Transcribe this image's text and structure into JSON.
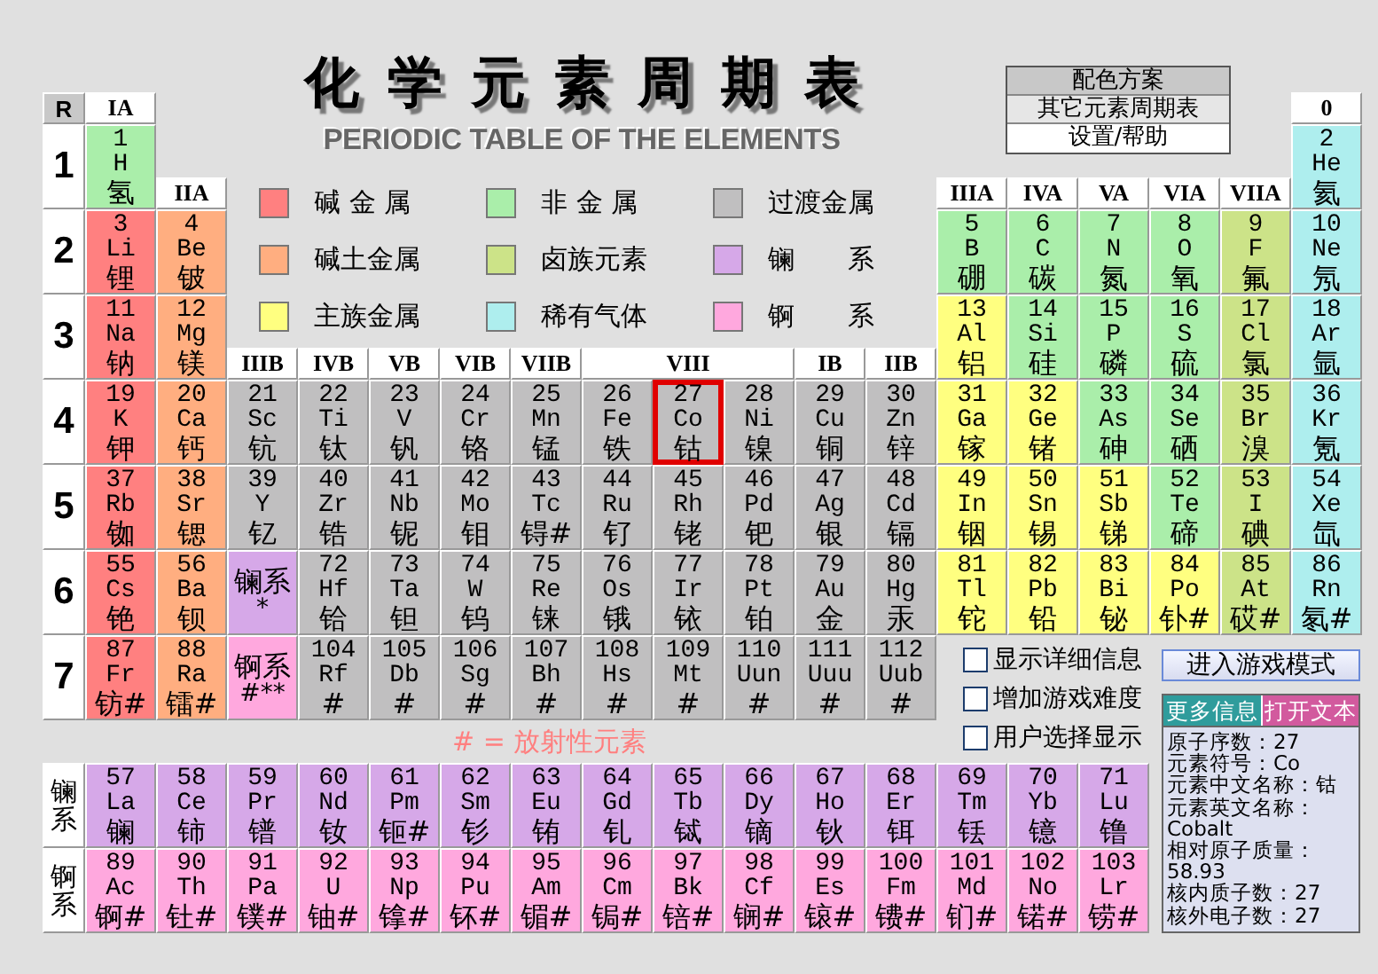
{
  "title": "化学元素周期表",
  "subtitle": "PERIODIC TABLE OF THE ELEMENTS",
  "menu": [
    {
      "label": "配色方案",
      "color": "#c8c8c8"
    },
    {
      "label": "其它元素周期表",
      "color": "#e6e6e6"
    },
    {
      "label": "设置/帮助",
      "color": "#ffffff"
    }
  ],
  "legend": [
    {
      "label": "碱 金 属",
      "kind": "alkali",
      "color": "#ff8080"
    },
    {
      "label": "非 金 属",
      "kind": "nonmetal",
      "color": "#aaeeaa"
    },
    {
      "label": "过渡金属",
      "kind": "transition",
      "color": "#c0bfc0"
    },
    {
      "label": "碱土金属",
      "kind": "alkaline",
      "color": "#ffae80"
    },
    {
      "label": "卤族元素",
      "kind": "halogen",
      "color": "#cce388"
    },
    {
      "label": "镧　　系",
      "kind": "lanthanide",
      "color": "#d6a8e8"
    },
    {
      "label": "主族金属",
      "kind": "metal",
      "color": "#ffff80"
    },
    {
      "label": "稀有气体",
      "kind": "noble",
      "color": "#aeeeee"
    },
    {
      "label": "锕　　系",
      "kind": "actinide",
      "color": "#ffa8de"
    }
  ],
  "corner_label": "R",
  "group_headers": [
    "IA",
    "IIA",
    "IIIB",
    "IVB",
    "VB",
    "VIB",
    "VIIB",
    "VIII",
    "IB",
    "IIB",
    "IIIA",
    "IVA",
    "VA",
    "VIA",
    "VIIA",
    "0"
  ],
  "period_labels": [
    "1",
    "2",
    "3",
    "4",
    "5",
    "6",
    "7"
  ],
  "series_markers": [
    {
      "label": "镧系",
      "mark": "*",
      "kind": "lanthanide"
    },
    {
      "label": "锕系",
      "mark": "#**",
      "kind": "actinide"
    }
  ],
  "series_labels": [
    "镧系",
    "锕系"
  ],
  "elements": [
    {
      "number": "1",
      "symbol": "H",
      "name": "氢",
      "kind": "nonmetal",
      "selected": false
    },
    {
      "number": "2",
      "symbol": "He",
      "name": "氦",
      "kind": "noble",
      "selected": false
    },
    {
      "number": "3",
      "symbol": "Li",
      "name": "锂",
      "kind": "alkali",
      "selected": false
    },
    {
      "number": "4",
      "symbol": "Be",
      "name": "铍",
      "kind": "alkaline",
      "selected": false
    },
    {
      "number": "5",
      "symbol": "B",
      "name": "硼",
      "kind": "nonmetal",
      "selected": false
    },
    {
      "number": "6",
      "symbol": "C",
      "name": "碳",
      "kind": "nonmetal",
      "selected": false
    },
    {
      "number": "7",
      "symbol": "N",
      "name": "氮",
      "kind": "nonmetal",
      "selected": false
    },
    {
      "number": "8",
      "symbol": "O",
      "name": "氧",
      "kind": "nonmetal",
      "selected": false
    },
    {
      "number": "9",
      "symbol": "F",
      "name": "氟",
      "kind": "halogen",
      "selected": false
    },
    {
      "number": "10",
      "symbol": "Ne",
      "name": "氖",
      "kind": "noble",
      "selected": false
    },
    {
      "number": "11",
      "symbol": "Na",
      "name": "钠",
      "kind": "alkali",
      "selected": false
    },
    {
      "number": "12",
      "symbol": "Mg",
      "name": "镁",
      "kind": "alkaline",
      "selected": false
    },
    {
      "number": "13",
      "symbol": "Al",
      "name": "铝",
      "kind": "metal",
      "selected": false
    },
    {
      "number": "14",
      "symbol": "Si",
      "name": "硅",
      "kind": "nonmetal",
      "selected": false
    },
    {
      "number": "15",
      "symbol": "P",
      "name": "磷",
      "kind": "nonmetal",
      "selected": false
    },
    {
      "number": "16",
      "symbol": "S",
      "name": "硫",
      "kind": "nonmetal",
      "selected": false
    },
    {
      "number": "17",
      "symbol": "Cl",
      "name": "氯",
      "kind": "halogen",
      "selected": false
    },
    {
      "number": "18",
      "symbol": "Ar",
      "name": "氩",
      "kind": "noble",
      "selected": false
    },
    {
      "number": "19",
      "symbol": "K",
      "name": "钾",
      "kind": "alkali",
      "selected": false
    },
    {
      "number": "20",
      "symbol": "Ca",
      "name": "钙",
      "kind": "alkaline",
      "selected": false
    },
    {
      "number": "21",
      "symbol": "Sc",
      "name": "钪",
      "kind": "transition",
      "selected": false
    },
    {
      "number": "22",
      "symbol": "Ti",
      "name": "钛",
      "kind": "transition",
      "selected": false
    },
    {
      "number": "23",
      "symbol": "V",
      "name": "钒",
      "kind": "transition",
      "selected": false
    },
    {
      "number": "24",
      "symbol": "Cr",
      "name": "铬",
      "kind": "transition",
      "selected": false
    },
    {
      "number": "25",
      "symbol": "Mn",
      "name": "锰",
      "kind": "transition",
      "selected": false
    },
    {
      "number": "26",
      "symbol": "Fe",
      "name": "铁",
      "kind": "transition",
      "selected": false
    },
    {
      "number": "27",
      "symbol": "Co",
      "name": "钴",
      "kind": "transition",
      "selected": true
    },
    {
      "number": "28",
      "symbol": "Ni",
      "name": "镍",
      "kind": "transition",
      "selected": false
    },
    {
      "number": "29",
      "symbol": "Cu",
      "name": "铜",
      "kind": "transition",
      "selected": false
    },
    {
      "number": "30",
      "symbol": "Zn",
      "name": "锌",
      "kind": "transition",
      "selected": false
    },
    {
      "number": "31",
      "symbol": "Ga",
      "name": "镓",
      "kind": "metal",
      "selected": false
    },
    {
      "number": "32",
      "symbol": "Ge",
      "name": "锗",
      "kind": "metal",
      "selected": false
    },
    {
      "number": "33",
      "symbol": "As",
      "name": "砷",
      "kind": "nonmetal",
      "selected": false
    },
    {
      "number": "34",
      "symbol": "Se",
      "name": "硒",
      "kind": "nonmetal",
      "selected": false
    },
    {
      "number": "35",
      "symbol": "Br",
      "name": "溴",
      "kind": "halogen",
      "selected": false
    },
    {
      "number": "36",
      "symbol": "Kr",
      "name": "氪",
      "kind": "noble",
      "selected": false
    },
    {
      "number": "37",
      "symbol": "Rb",
      "name": "铷",
      "kind": "alkali",
      "selected": false
    },
    {
      "number": "38",
      "symbol": "Sr",
      "name": "锶",
      "kind": "alkaline",
      "selected": false
    },
    {
      "number": "39",
      "symbol": "Y",
      "name": "钇",
      "kind": "transition",
      "selected": false
    },
    {
      "number": "40",
      "symbol": "Zr",
      "name": "锆",
      "kind": "transition",
      "selected": false
    },
    {
      "number": "41",
      "symbol": "Nb",
      "name": "铌",
      "kind": "transition",
      "selected": false
    },
    {
      "number": "42",
      "symbol": "Mo",
      "name": "钼",
      "kind": "transition",
      "selected": false
    },
    {
      "number": "43",
      "symbol": "Tc",
      "name": "锝#",
      "kind": "transition",
      "selected": false
    },
    {
      "number": "44",
      "symbol": "Ru",
      "name": "钌",
      "kind": "transition",
      "selected": false
    },
    {
      "number": "45",
      "symbol": "Rh",
      "name": "铑",
      "kind": "transition",
      "selected": false
    },
    {
      "number": "46",
      "symbol": "Pd",
      "name": "钯",
      "kind": "transition",
      "selected": false
    },
    {
      "number": "47",
      "symbol": "Ag",
      "name": "银",
      "kind": "transition",
      "selected": false
    },
    {
      "number": "48",
      "symbol": "Cd",
      "name": "镉",
      "kind": "transition",
      "selected": false
    },
    {
      "number": "49",
      "symbol": "In",
      "name": "铟",
      "kind": "metal",
      "selected": false
    },
    {
      "number": "50",
      "symbol": "Sn",
      "name": "锡",
      "kind": "metal",
      "selected": false
    },
    {
      "number": "51",
      "symbol": "Sb",
      "name": "锑",
      "kind": "metal",
      "selected": false
    },
    {
      "number": "52",
      "symbol": "Te",
      "name": "碲",
      "kind": "nonmetal",
      "selected": false
    },
    {
      "number": "53",
      "symbol": "I",
      "name": "碘",
      "kind": "halogen",
      "selected": false
    },
    {
      "number": "54",
      "symbol": "Xe",
      "name": "氙",
      "kind": "noble",
      "selected": false
    },
    {
      "number": "55",
      "symbol": "Cs",
      "name": "铯",
      "kind": "alkali",
      "selected": false
    },
    {
      "number": "56",
      "symbol": "Ba",
      "name": "钡",
      "kind": "alkaline",
      "selected": false
    },
    {
      "number": "57",
      "symbol": "La",
      "name": "镧",
      "kind": "lanthanide",
      "selected": false
    },
    {
      "number": "58",
      "symbol": "Ce",
      "name": "铈",
      "kind": "lanthanide",
      "selected": false
    },
    {
      "number": "59",
      "symbol": "Pr",
      "name": "镨",
      "kind": "lanthanide",
      "selected": false
    },
    {
      "number": "60",
      "symbol": "Nd",
      "name": "钕",
      "kind": "lanthanide",
      "selected": false
    },
    {
      "number": "61",
      "symbol": "Pm",
      "name": "钷#",
      "kind": "lanthanide",
      "selected": false
    },
    {
      "number": "62",
      "symbol": "Sm",
      "name": "钐",
      "kind": "lanthanide",
      "selected": false
    },
    {
      "number": "63",
      "symbol": "Eu",
      "name": "铕",
      "kind": "lanthanide",
      "selected": false
    },
    {
      "number": "64",
      "symbol": "Gd",
      "name": "钆",
      "kind": "lanthanide",
      "selected": false
    },
    {
      "number": "65",
      "symbol": "Tb",
      "name": "铽",
      "kind": "lanthanide",
      "selected": false
    },
    {
      "number": "66",
      "symbol": "Dy",
      "name": "镝",
      "kind": "lanthanide",
      "selected": false
    },
    {
      "number": "67",
      "symbol": "Ho",
      "name": "钬",
      "kind": "lanthanide",
      "selected": false
    },
    {
      "number": "68",
      "symbol": "Er",
      "name": "铒",
      "kind": "lanthanide",
      "selected": false
    },
    {
      "number": "69",
      "symbol": "Tm",
      "name": "铥",
      "kind": "lanthanide",
      "selected": false
    },
    {
      "number": "70",
      "symbol": "Yb",
      "name": "镱",
      "kind": "lanthanide",
      "selected": false
    },
    {
      "number": "71",
      "symbol": "Lu",
      "name": "镥",
      "kind": "lanthanide",
      "selected": false
    },
    {
      "number": "72",
      "symbol": "Hf",
      "name": "铪",
      "kind": "transition",
      "selected": false
    },
    {
      "number": "73",
      "symbol": "Ta",
      "name": "钽",
      "kind": "transition",
      "selected": false
    },
    {
      "number": "74",
      "symbol": "W",
      "name": "钨",
      "kind": "transition",
      "selected": false
    },
    {
      "number": "75",
      "symbol": "Re",
      "name": "铼",
      "kind": "transition",
      "selected": false
    },
    {
      "number": "76",
      "symbol": "Os",
      "name": "锇",
      "kind": "transition",
      "selected": false
    },
    {
      "number": "77",
      "symbol": "Ir",
      "name": "铱",
      "kind": "transition",
      "selected": false
    },
    {
      "number": "78",
      "symbol": "Pt",
      "name": "铂",
      "kind": "transition",
      "selected": false
    },
    {
      "number": "79",
      "symbol": "Au",
      "name": "金",
      "kind": "transition",
      "selected": false
    },
    {
      "number": "80",
      "symbol": "Hg",
      "name": "汞",
      "kind": "transition",
      "selected": false
    },
    {
      "number": "81",
      "symbol": "Tl",
      "name": "铊",
      "kind": "metal",
      "selected": false
    },
    {
      "number": "82",
      "symbol": "Pb",
      "name": "铅",
      "kind": "metal",
      "selected": false
    },
    {
      "number": "83",
      "symbol": "Bi",
      "name": "铋",
      "kind": "metal",
      "selected": false
    },
    {
      "number": "84",
      "symbol": "Po",
      "name": "钋#",
      "kind": "metal",
      "selected": false
    },
    {
      "number": "85",
      "symbol": "At",
      "name": "砹#",
      "kind": "halogen",
      "selected": false
    },
    {
      "number": "86",
      "symbol": "Rn",
      "name": "氡#",
      "kind": "noble",
      "selected": false
    },
    {
      "number": "87",
      "symbol": "Fr",
      "name": "钫#",
      "kind": "alkali",
      "selected": false
    },
    {
      "number": "88",
      "symbol": "Ra",
      "name": "镭#",
      "kind": "alkaline",
      "selected": false
    },
    {
      "number": "89",
      "symbol": "Ac",
      "name": "锕#",
      "kind": "actinide",
      "selected": false
    },
    {
      "number": "90",
      "symbol": "Th",
      "name": "钍#",
      "kind": "actinide",
      "selected": false
    },
    {
      "number": "91",
      "symbol": "Pa",
      "name": "镤#",
      "kind": "actinide",
      "selected": false
    },
    {
      "number": "92",
      "symbol": "U",
      "name": "铀#",
      "kind": "actinide",
      "selected": false
    },
    {
      "number": "93",
      "symbol": "Np",
      "name": "镎#",
      "kind": "actinide",
      "selected": false
    },
    {
      "number": "94",
      "symbol": "Pu",
      "name": "钚#",
      "kind": "actinide",
      "selected": false
    },
    {
      "number": "95",
      "symbol": "Am",
      "name": "镅#",
      "kind": "actinide",
      "selected": false
    },
    {
      "number": "96",
      "symbol": "Cm",
      "name": "锔#",
      "kind": "actinide",
      "selected": false
    },
    {
      "number": "97",
      "symbol": "Bk",
      "name": "锫#",
      "kind": "actinide",
      "selected": false
    },
    {
      "number": "98",
      "symbol": "Cf",
      "name": "锎#",
      "kind": "actinide",
      "selected": false
    },
    {
      "number": "99",
      "symbol": "Es",
      "name": "锿#",
      "kind": "actinide",
      "selected": false
    },
    {
      "number": "100",
      "symbol": "Fm",
      "name": "镄#",
      "kind": "actinide",
      "selected": false
    },
    {
      "number": "101",
      "symbol": "Md",
      "name": "钔#",
      "kind": "actinide",
      "selected": false
    },
    {
      "number": "102",
      "symbol": "No",
      "name": "锘#",
      "kind": "actinide",
      "selected": false
    },
    {
      "number": "103",
      "symbol": "Lr",
      "name": "铹#",
      "kind": "actinide",
      "selected": false
    },
    {
      "number": "104",
      "symbol": "Rf",
      "name": "#",
      "kind": "transition",
      "selected": false
    },
    {
      "number": "105",
      "symbol": "Db",
      "name": "#",
      "kind": "transition",
      "selected": false
    },
    {
      "number": "106",
      "symbol": "Sg",
      "name": "#",
      "kind": "transition",
      "selected": false
    },
    {
      "number": "107",
      "symbol": "Bh",
      "name": "#",
      "kind": "transition",
      "selected": false
    },
    {
      "number": "108",
      "symbol": "Hs",
      "name": "#",
      "kind": "transition",
      "selected": false
    },
    {
      "number": "109",
      "symbol": "Mt",
      "name": "#",
      "kind": "transition",
      "selected": false
    },
    {
      "number": "110",
      "symbol": "Uun",
      "name": "#",
      "kind": "transition",
      "selected": false
    },
    {
      "number": "111",
      "symbol": "Uuu",
      "name": "#",
      "kind": "transition",
      "selected": false
    },
    {
      "number": "112",
      "symbol": "Uub",
      "name": "#",
      "kind": "transition",
      "selected": false
    }
  ],
  "note": "# = 放射性元素",
  "options": [
    {
      "label": "显示详细信息",
      "checked": false
    },
    {
      "label": "增加游戏难度",
      "checked": false
    },
    {
      "label": "用户选择显示",
      "checked": false
    }
  ],
  "game_button": "进入游戏模式",
  "info": {
    "buttons": [
      {
        "label": "更多信息",
        "color": "#2f9c9c"
      },
      {
        "label": "打开文本",
        "color": "#d25a9e"
      }
    ],
    "lines": [
      "原子序数：27",
      "元素符号：Co",
      "元素中文名称：钴",
      "元素英文名称：",
      "Cobalt",
      "相对原子质量：",
      "58.93",
      "核内质子数：27",
      "核外电子数：27"
    ]
  }
}
